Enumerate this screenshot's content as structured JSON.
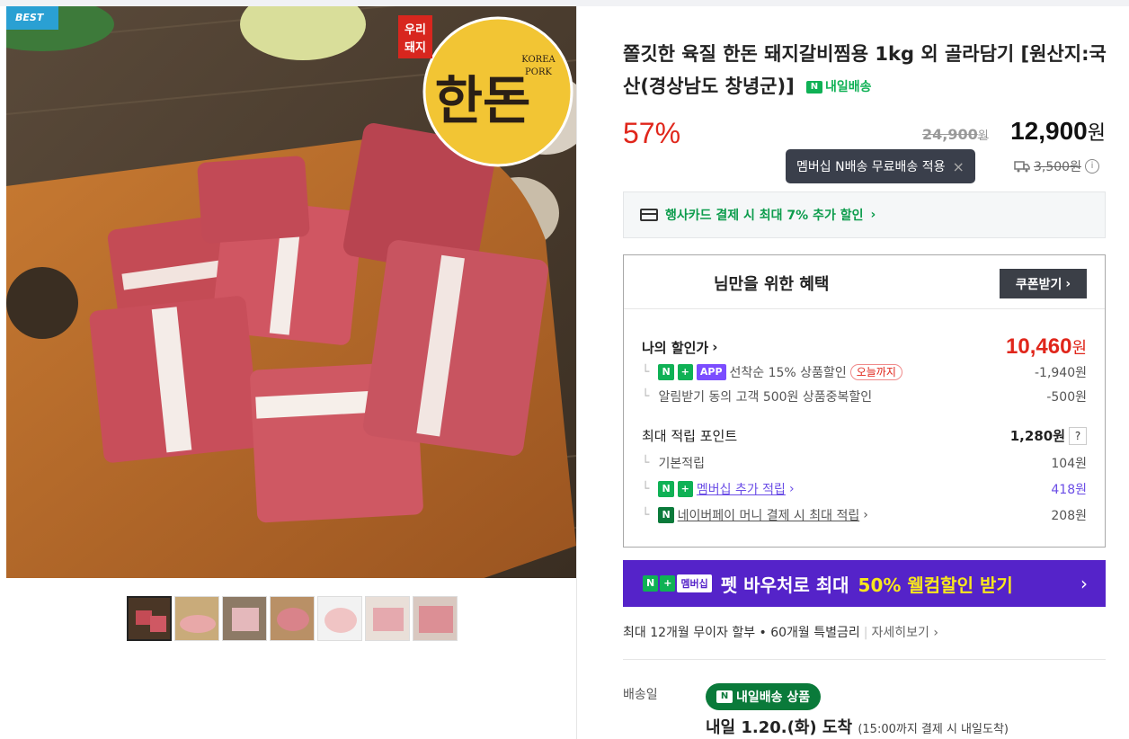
{
  "badge": "BEST",
  "logo": {
    "line1": "우리",
    "line2": "돼지",
    "brand": "한돈",
    "tag1": "KOREA",
    "tag2": "PORK"
  },
  "product": {
    "title": "쫄깃한 육질 한돈 돼지갈비찜용 1kg 외 골라담기 [원산지:국산(경상남도 창녕군)]",
    "delivery_badge": "내일배송",
    "discount": "57%",
    "original_price": "24,900",
    "original_unit": "원",
    "price": "12,900",
    "price_unit": "원"
  },
  "tooltip": {
    "text": "멤버십 N배송 무료배송 적용",
    "close": "×"
  },
  "shipping": {
    "fee": "3,500원",
    "info": "i"
  },
  "card_promo": "행사카드 결제 시 최대 7% 추가 할인",
  "benefit": {
    "title": "님만을 위한 혜택",
    "coupon_button": "쿠폰받기",
    "my_price_label": "나의 할인가",
    "my_price": "10,460",
    "my_price_unit": "원",
    "disc1_app": "APP",
    "disc1_text": "선착순 15% 상품할인",
    "disc1_pill": "오늘까지",
    "disc1_value": "-1,940원",
    "disc2_text": "알림받기 동의 고객 500원 상품중복할인",
    "disc2_value": "-500원",
    "points_label": "최대 적립 포인트",
    "points_value": "1,280원",
    "points_help": "?",
    "base_label": "기본적립",
    "base_value": "104원",
    "member_label": "멤버십 추가 적립",
    "member_value": "418원",
    "pay_label": "네이버페이 머니 결제 시 최대 적립",
    "pay_value": "208원"
  },
  "promo": {
    "badge": "멤버십",
    "text1": "펫 바우처로 최대",
    "text2": "50% 웰컴할인 받기"
  },
  "installment": {
    "text": "최대 12개월 무이자 할부 • 60개월 특별금리",
    "more": "자세히보기"
  },
  "delivery": {
    "label": "배송일",
    "badge": "내일배송 상품",
    "date": "내일 1.20.(화) 도착",
    "note": "(15:00까지 결제 시 내일도착)"
  },
  "colors": {
    "accent_red": "#e0261b",
    "naver_green": "#0fb155",
    "promo_purple": "#5523c9"
  }
}
